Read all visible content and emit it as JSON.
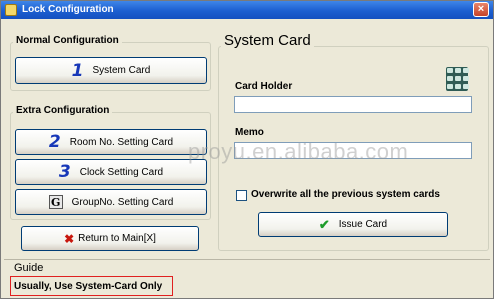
{
  "window": {
    "title": "Lock Configuration",
    "close_glyph": "×"
  },
  "normal": {
    "title": "Normal Configuration",
    "system_card_number": "1",
    "system_card_label": "System Card"
  },
  "extra": {
    "title": "Extra Configuration",
    "buttons": [
      {
        "number": "2",
        "label": "Room No. Setting Card"
      },
      {
        "number": "3",
        "label": "Clock Setting Card"
      },
      {
        "number": "G",
        "label": "GroupNo. Setting Card"
      }
    ]
  },
  "return": {
    "label": "Return to Main[X]",
    "icon": "x-icon"
  },
  "system_card": {
    "title": "System Card",
    "card_holder_label": "Card Holder",
    "card_holder_value": "",
    "memo_label": "Memo",
    "memo_value": "",
    "overwrite_label": "Overwrite all the previous system cards",
    "overwrite_checked": false,
    "issue_label": "Issue Card",
    "icon": "keypad-icon"
  },
  "guide": {
    "title": "Guide",
    "message": "Usually, Use System-Card Only"
  },
  "watermark": "proyu.en.alibaba.com",
  "colors": {
    "titlebar": "#1c5fd0",
    "background": "#ece9d8",
    "number_blue": "#1838b8",
    "guide_border": "#e02020"
  }
}
